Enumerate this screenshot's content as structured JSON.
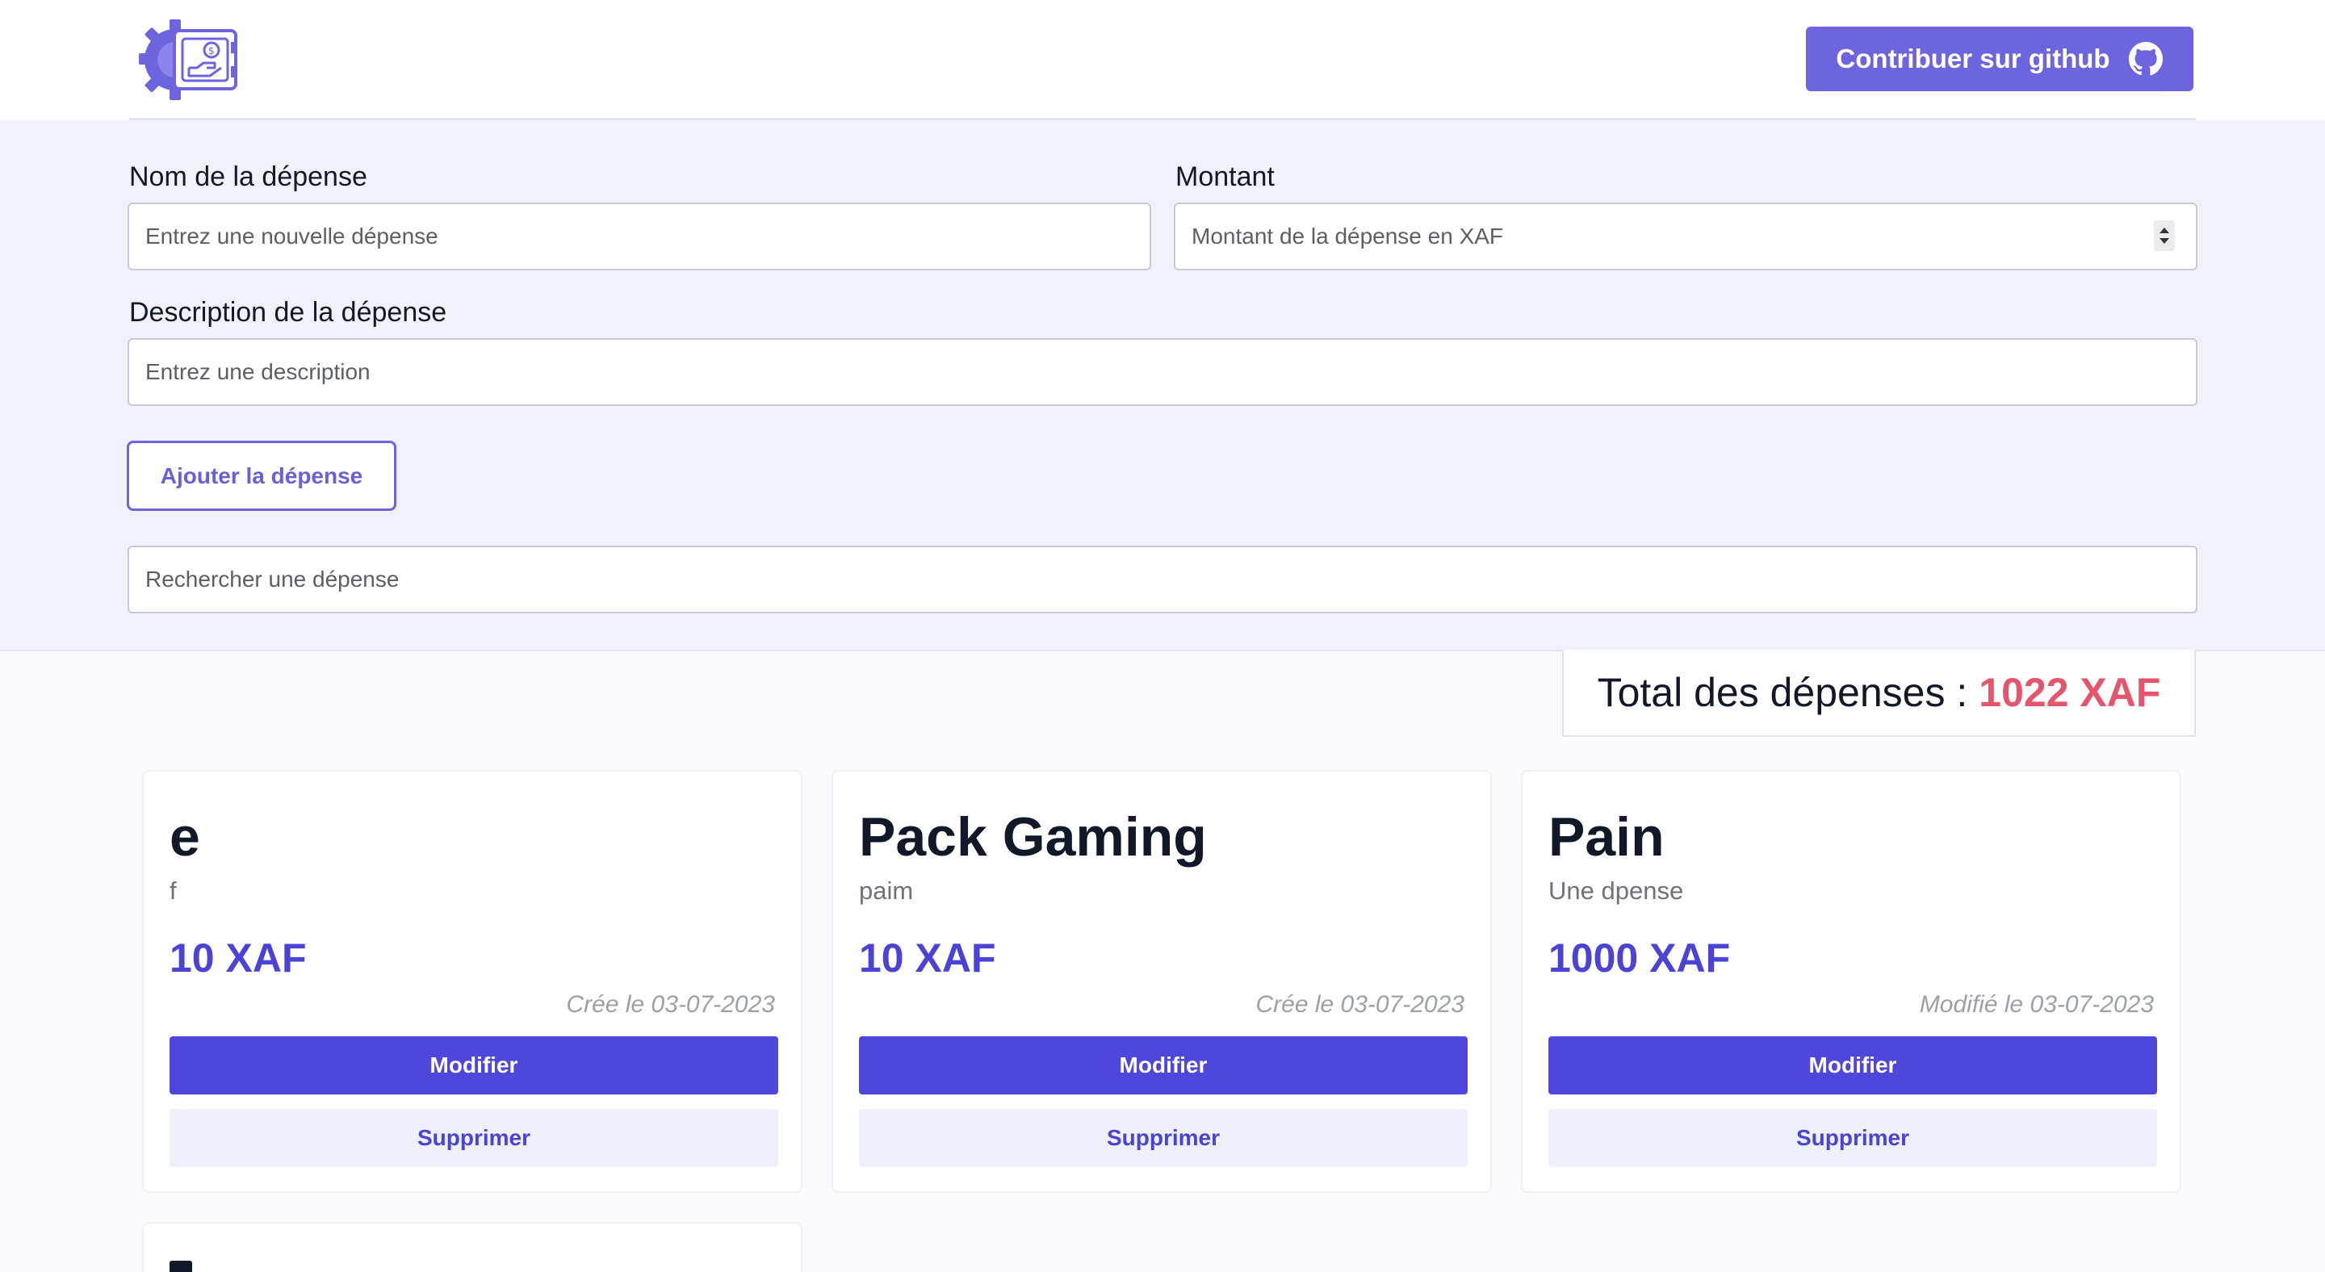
{
  "header": {
    "github_label": "Contribuer sur github",
    "logo_icon": "safe-money-gear-icon",
    "github_icon": "github-icon",
    "accent": "#6d65dd"
  },
  "form": {
    "name_label": "Nom de la dépense",
    "name_placeholder": "Entrez une nouvelle dépense",
    "amount_label": "Montant",
    "amount_placeholder": "Montant de la dépense en XAF",
    "description_label": "Description de la dépense",
    "description_placeholder": "Entrez une description",
    "add_button": "Ajouter la dépense",
    "search_placeholder": "Rechercher une dépense"
  },
  "total": {
    "label": "Total des dépenses :",
    "amount": "1022 XAF",
    "amount_color": "#e5556b"
  },
  "expenses": [
    {
      "title": "e",
      "description": "f",
      "amount": "10 XAF",
      "date": "Crée le 03-07-2023",
      "edit_label": "Modifier",
      "delete_label": "Supprimer"
    },
    {
      "title": "Pack Gaming",
      "description": "paim",
      "amount": "10 XAF",
      "date": "Crée le 03-07-2023",
      "edit_label": "Modifier",
      "delete_label": "Supprimer"
    },
    {
      "title": "Pain",
      "description": "Une dpense",
      "amount": "1000 XAF",
      "date": "Modifié le 03-07-2023",
      "edit_label": "Modifier",
      "delete_label": "Supprimer"
    }
  ]
}
